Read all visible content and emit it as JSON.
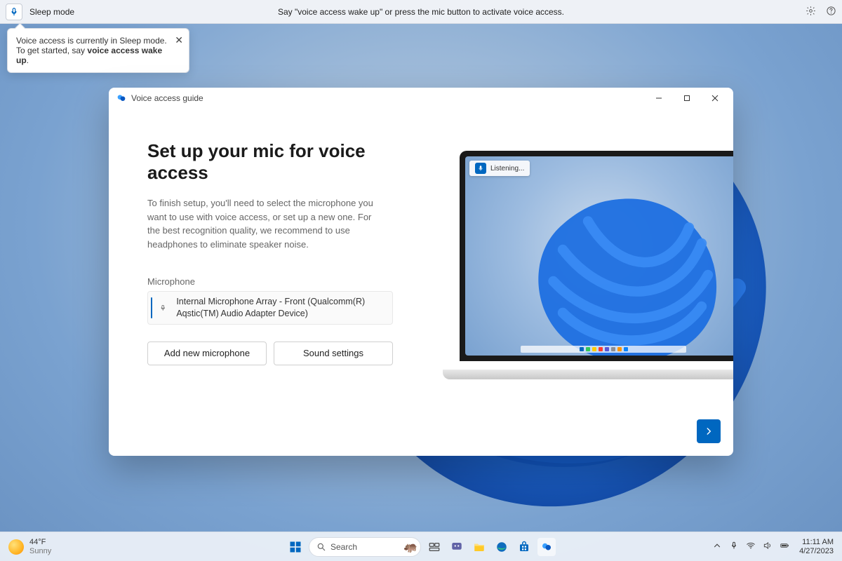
{
  "topbar": {
    "status": "Sleep mode",
    "hint": "Say \"voice access wake up\" or press the mic button to activate voice access."
  },
  "tooltip": {
    "line1": "Voice access is currently in Sleep mode. To get started, say ",
    "bold": "voice access wake up",
    "tail": "."
  },
  "window": {
    "title": "Voice access guide",
    "heading": "Set up your mic for voice access",
    "body": "To finish setup, you'll need to select the microphone you want to use with voice access, or set up a new one. For the best recognition quality, we recommend to use headphones to eliminate speaker noise.",
    "section_label": "Microphone",
    "selected_mic": "Internal Microphone Array - Front (Qualcomm(R) Aqstic(TM) Audio Adapter Device)",
    "buttons": {
      "add": "Add new microphone",
      "sound": "Sound settings"
    },
    "laptop_status": "Listening..."
  },
  "taskbar": {
    "temp": "44°F",
    "weather": "Sunny",
    "search_placeholder": "Search",
    "time": "11:11 AM",
    "date": "4/27/2023"
  },
  "colors": {
    "accent": "#0067c0"
  }
}
